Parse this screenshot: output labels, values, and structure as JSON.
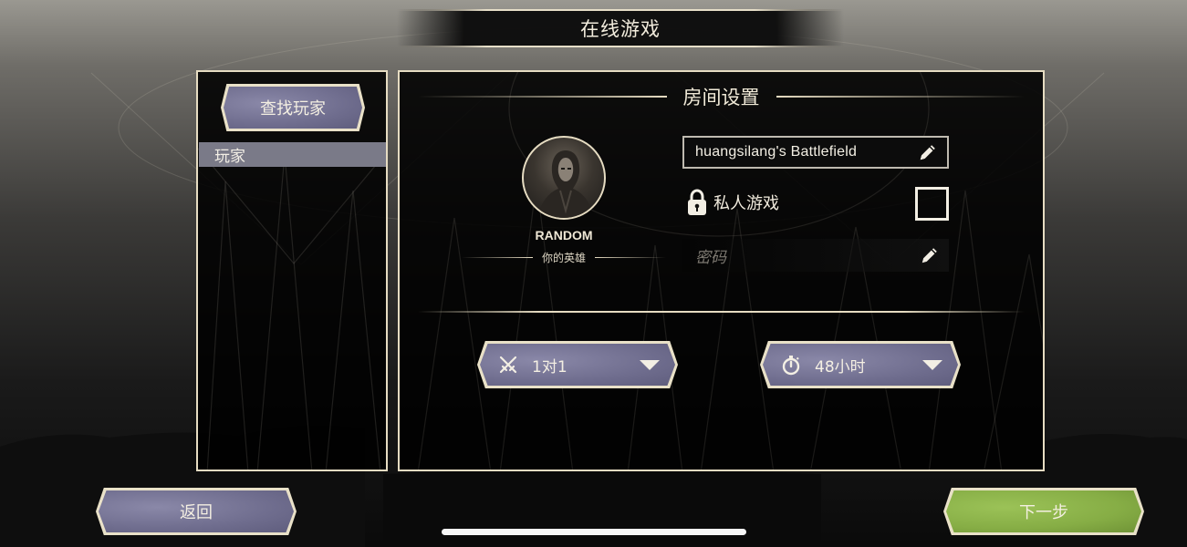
{
  "header": {
    "title": "在线游戏"
  },
  "players_panel": {
    "find_players_label": "查找玩家",
    "list": [
      {
        "label": "玩家"
      }
    ]
  },
  "room_settings": {
    "title": "房间设置",
    "hero": {
      "name": "RANDOM",
      "caption": "你的英雄"
    },
    "room_name": "huangsilang's Battlefield",
    "private_game_label": "私人游戏",
    "private_checked": false,
    "password_placeholder": "密码",
    "mode": {
      "value": "1对1",
      "icon": "crossed-swords-icon"
    },
    "duration": {
      "value": "48小时",
      "icon": "stopwatch-icon"
    }
  },
  "footer": {
    "back_label": "返回",
    "next_label": "下一步"
  },
  "colors": {
    "frame": "#e6dcc2",
    "button_purple": "#6f6d8e",
    "button_green": "#86ad45",
    "panel_bg": "#000000"
  }
}
